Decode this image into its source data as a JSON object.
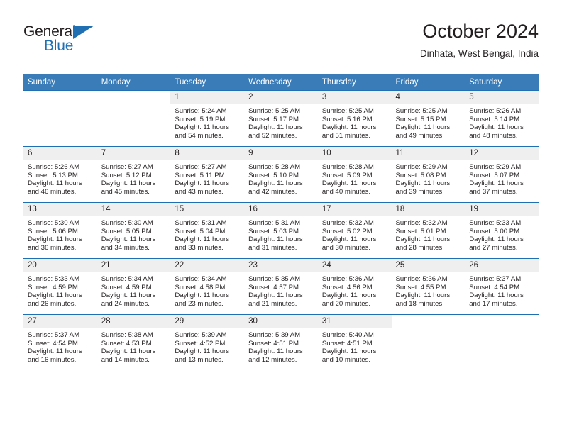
{
  "logo": {
    "word_top": "General",
    "word_bottom": "Blue",
    "triangle_color": "#1f6fb2"
  },
  "header": {
    "title": "October 2024",
    "subtitle": "Dinhata, West Bengal, India"
  },
  "theme": {
    "header_row_bg": "#3a7cb8",
    "row_divider": "#1f6fb2",
    "daynum_bg": "#efefef",
    "text": "#231f20"
  },
  "weekday_headers": [
    "Sunday",
    "Monday",
    "Tuesday",
    "Wednesday",
    "Thursday",
    "Friday",
    "Saturday"
  ],
  "weeks": [
    [
      {
        "day": "",
        "sunrise": "",
        "sunset": "",
        "daylight_line1": "",
        "daylight_line2": ""
      },
      {
        "day": "",
        "sunrise": "",
        "sunset": "",
        "daylight_line1": "",
        "daylight_line2": ""
      },
      {
        "day": "1",
        "sunrise": "Sunrise: 5:24 AM",
        "sunset": "Sunset: 5:19 PM",
        "daylight_line1": "Daylight: 11 hours",
        "daylight_line2": "and 54 minutes."
      },
      {
        "day": "2",
        "sunrise": "Sunrise: 5:25 AM",
        "sunset": "Sunset: 5:17 PM",
        "daylight_line1": "Daylight: 11 hours",
        "daylight_line2": "and 52 minutes."
      },
      {
        "day": "3",
        "sunrise": "Sunrise: 5:25 AM",
        "sunset": "Sunset: 5:16 PM",
        "daylight_line1": "Daylight: 11 hours",
        "daylight_line2": "and 51 minutes."
      },
      {
        "day": "4",
        "sunrise": "Sunrise: 5:25 AM",
        "sunset": "Sunset: 5:15 PM",
        "daylight_line1": "Daylight: 11 hours",
        "daylight_line2": "and 49 minutes."
      },
      {
        "day": "5",
        "sunrise": "Sunrise: 5:26 AM",
        "sunset": "Sunset: 5:14 PM",
        "daylight_line1": "Daylight: 11 hours",
        "daylight_line2": "and 48 minutes."
      }
    ],
    [
      {
        "day": "6",
        "sunrise": "Sunrise: 5:26 AM",
        "sunset": "Sunset: 5:13 PM",
        "daylight_line1": "Daylight: 11 hours",
        "daylight_line2": "and 46 minutes."
      },
      {
        "day": "7",
        "sunrise": "Sunrise: 5:27 AM",
        "sunset": "Sunset: 5:12 PM",
        "daylight_line1": "Daylight: 11 hours",
        "daylight_line2": "and 45 minutes."
      },
      {
        "day": "8",
        "sunrise": "Sunrise: 5:27 AM",
        "sunset": "Sunset: 5:11 PM",
        "daylight_line1": "Daylight: 11 hours",
        "daylight_line2": "and 43 minutes."
      },
      {
        "day": "9",
        "sunrise": "Sunrise: 5:28 AM",
        "sunset": "Sunset: 5:10 PM",
        "daylight_line1": "Daylight: 11 hours",
        "daylight_line2": "and 42 minutes."
      },
      {
        "day": "10",
        "sunrise": "Sunrise: 5:28 AM",
        "sunset": "Sunset: 5:09 PM",
        "daylight_line1": "Daylight: 11 hours",
        "daylight_line2": "and 40 minutes."
      },
      {
        "day": "11",
        "sunrise": "Sunrise: 5:29 AM",
        "sunset": "Sunset: 5:08 PM",
        "daylight_line1": "Daylight: 11 hours",
        "daylight_line2": "and 39 minutes."
      },
      {
        "day": "12",
        "sunrise": "Sunrise: 5:29 AM",
        "sunset": "Sunset: 5:07 PM",
        "daylight_line1": "Daylight: 11 hours",
        "daylight_line2": "and 37 minutes."
      }
    ],
    [
      {
        "day": "13",
        "sunrise": "Sunrise: 5:30 AM",
        "sunset": "Sunset: 5:06 PM",
        "daylight_line1": "Daylight: 11 hours",
        "daylight_line2": "and 36 minutes."
      },
      {
        "day": "14",
        "sunrise": "Sunrise: 5:30 AM",
        "sunset": "Sunset: 5:05 PM",
        "daylight_line1": "Daylight: 11 hours",
        "daylight_line2": "and 34 minutes."
      },
      {
        "day": "15",
        "sunrise": "Sunrise: 5:31 AM",
        "sunset": "Sunset: 5:04 PM",
        "daylight_line1": "Daylight: 11 hours",
        "daylight_line2": "and 33 minutes."
      },
      {
        "day": "16",
        "sunrise": "Sunrise: 5:31 AM",
        "sunset": "Sunset: 5:03 PM",
        "daylight_line1": "Daylight: 11 hours",
        "daylight_line2": "and 31 minutes."
      },
      {
        "day": "17",
        "sunrise": "Sunrise: 5:32 AM",
        "sunset": "Sunset: 5:02 PM",
        "daylight_line1": "Daylight: 11 hours",
        "daylight_line2": "and 30 minutes."
      },
      {
        "day": "18",
        "sunrise": "Sunrise: 5:32 AM",
        "sunset": "Sunset: 5:01 PM",
        "daylight_line1": "Daylight: 11 hours",
        "daylight_line2": "and 28 minutes."
      },
      {
        "day": "19",
        "sunrise": "Sunrise: 5:33 AM",
        "sunset": "Sunset: 5:00 PM",
        "daylight_line1": "Daylight: 11 hours",
        "daylight_line2": "and 27 minutes."
      }
    ],
    [
      {
        "day": "20",
        "sunrise": "Sunrise: 5:33 AM",
        "sunset": "Sunset: 4:59 PM",
        "daylight_line1": "Daylight: 11 hours",
        "daylight_line2": "and 26 minutes."
      },
      {
        "day": "21",
        "sunrise": "Sunrise: 5:34 AM",
        "sunset": "Sunset: 4:59 PM",
        "daylight_line1": "Daylight: 11 hours",
        "daylight_line2": "and 24 minutes."
      },
      {
        "day": "22",
        "sunrise": "Sunrise: 5:34 AM",
        "sunset": "Sunset: 4:58 PM",
        "daylight_line1": "Daylight: 11 hours",
        "daylight_line2": "and 23 minutes."
      },
      {
        "day": "23",
        "sunrise": "Sunrise: 5:35 AM",
        "sunset": "Sunset: 4:57 PM",
        "daylight_line1": "Daylight: 11 hours",
        "daylight_line2": "and 21 minutes."
      },
      {
        "day": "24",
        "sunrise": "Sunrise: 5:36 AM",
        "sunset": "Sunset: 4:56 PM",
        "daylight_line1": "Daylight: 11 hours",
        "daylight_line2": "and 20 minutes."
      },
      {
        "day": "25",
        "sunrise": "Sunrise: 5:36 AM",
        "sunset": "Sunset: 4:55 PM",
        "daylight_line1": "Daylight: 11 hours",
        "daylight_line2": "and 18 minutes."
      },
      {
        "day": "26",
        "sunrise": "Sunrise: 5:37 AM",
        "sunset": "Sunset: 4:54 PM",
        "daylight_line1": "Daylight: 11 hours",
        "daylight_line2": "and 17 minutes."
      }
    ],
    [
      {
        "day": "27",
        "sunrise": "Sunrise: 5:37 AM",
        "sunset": "Sunset: 4:54 PM",
        "daylight_line1": "Daylight: 11 hours",
        "daylight_line2": "and 16 minutes."
      },
      {
        "day": "28",
        "sunrise": "Sunrise: 5:38 AM",
        "sunset": "Sunset: 4:53 PM",
        "daylight_line1": "Daylight: 11 hours",
        "daylight_line2": "and 14 minutes."
      },
      {
        "day": "29",
        "sunrise": "Sunrise: 5:39 AM",
        "sunset": "Sunset: 4:52 PM",
        "daylight_line1": "Daylight: 11 hours",
        "daylight_line2": "and 13 minutes."
      },
      {
        "day": "30",
        "sunrise": "Sunrise: 5:39 AM",
        "sunset": "Sunset: 4:51 PM",
        "daylight_line1": "Daylight: 11 hours",
        "daylight_line2": "and 12 minutes."
      },
      {
        "day": "31",
        "sunrise": "Sunrise: 5:40 AM",
        "sunset": "Sunset: 4:51 PM",
        "daylight_line1": "Daylight: 11 hours",
        "daylight_line2": "and 10 minutes."
      },
      {
        "day": "",
        "sunrise": "",
        "sunset": "",
        "daylight_line1": "",
        "daylight_line2": ""
      },
      {
        "day": "",
        "sunrise": "",
        "sunset": "",
        "daylight_line1": "",
        "daylight_line2": ""
      }
    ]
  ]
}
